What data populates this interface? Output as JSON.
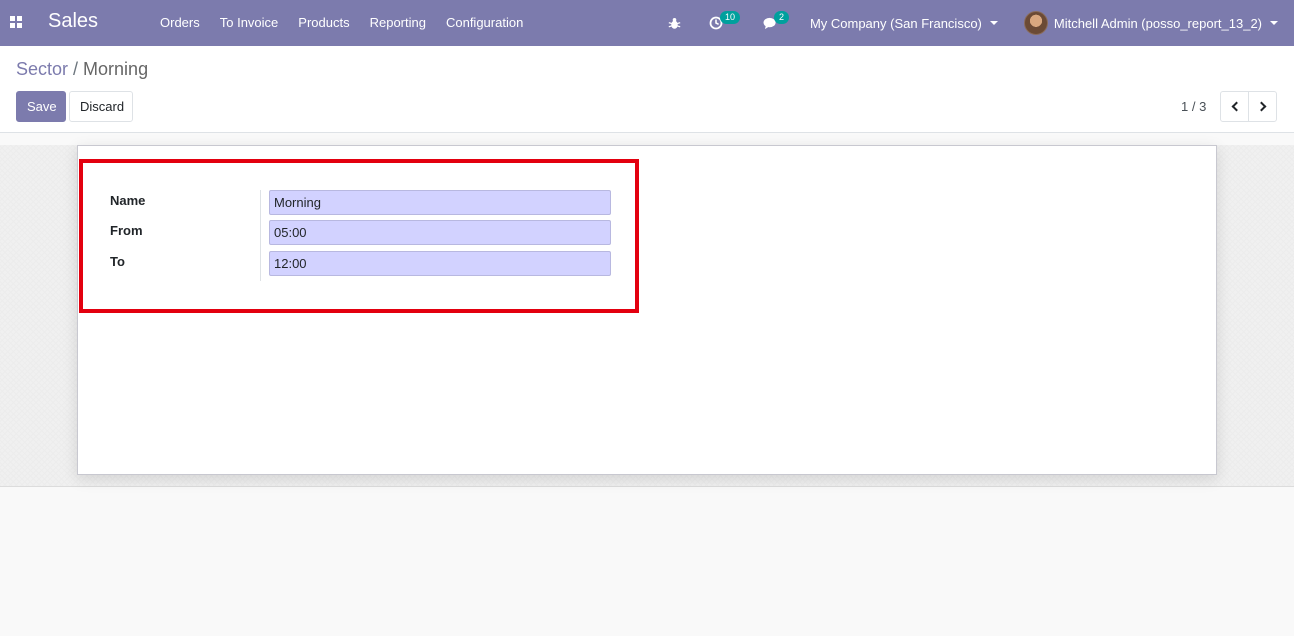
{
  "navbar": {
    "brand": "Sales",
    "menu": [
      "Orders",
      "To Invoice",
      "Products",
      "Reporting",
      "Configuration"
    ],
    "activity_count": "10",
    "message_count": "2",
    "company": "My Company (San Francisco)",
    "user": "Mitchell Admin (posso_report_13_2)",
    "accent": "#7c7bad"
  },
  "breadcrumb": {
    "parent": "Sector",
    "separator": "/",
    "current": "Morning"
  },
  "buttons": {
    "save": "Save",
    "discard": "Discard"
  },
  "pager": {
    "value": "1 / 3"
  },
  "form": {
    "name_label": "Name",
    "name_value": "Morning",
    "from_label": "From",
    "from_value": "05:00",
    "to_label": "To",
    "to_value": "12:00"
  },
  "icons": [
    "apps-icon",
    "bug-icon",
    "clock-icon",
    "chat-icon",
    "chevron-left-icon",
    "chevron-right-icon"
  ]
}
